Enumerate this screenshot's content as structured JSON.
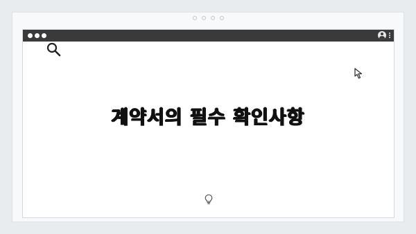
{
  "content": {
    "headline": "계약서의 필수 확인사항"
  },
  "icons": {
    "search": "search-icon",
    "cursor": "cursor-arrow-icon",
    "idea": "lightbulb-icon",
    "user": "user-icon",
    "menu": "kebab-menu-icon"
  },
  "colors": {
    "background": "#e9ecef",
    "titlebar": "#3a3a3a",
    "text": "#111111"
  }
}
